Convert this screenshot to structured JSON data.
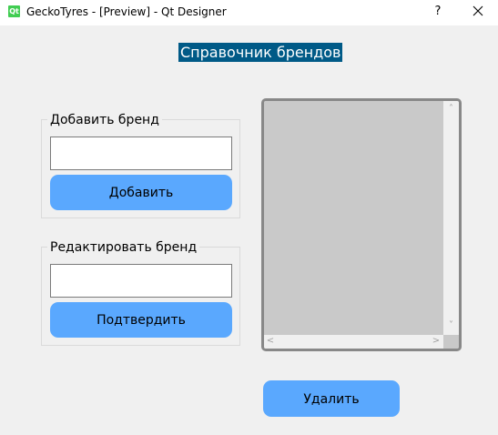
{
  "window": {
    "title": "GeckoTyres - [Preview] - Qt Designer",
    "icon_text": "Qt",
    "help_label": "?"
  },
  "heading": "Справочник брендов",
  "add_group": {
    "title": "Добавить бренд",
    "input_value": "",
    "button_label": "Добавить"
  },
  "edit_group": {
    "title": "Редактировать бренд",
    "input_value": "",
    "button_label": "Подтвердить"
  },
  "brand_list": {
    "items": [],
    "scroll_up": "˄",
    "scroll_down": "˅",
    "scroll_left": "<",
    "scroll_right": ">"
  },
  "delete_button_label": "Удалить",
  "colors": {
    "button_blue": "#5aa8fe",
    "heading_bg": "#005a87",
    "window_bg": "#f0f0f0",
    "list_bg": "#c9c9c9"
  }
}
